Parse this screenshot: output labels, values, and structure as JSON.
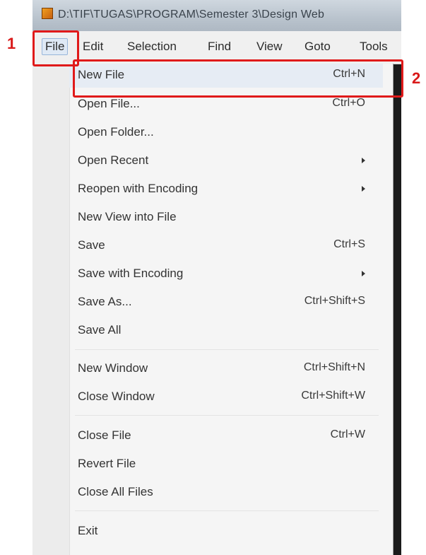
{
  "annotations": {
    "step1": "1",
    "step2": "2"
  },
  "window": {
    "title": "D:\\TIF\\TUGAS\\PROGRAM\\Semester 3\\Design Web"
  },
  "menubar": {
    "file": "File",
    "edit": "Edit",
    "selection": "Selection",
    "find": "Find",
    "view": "View",
    "goto": "Goto",
    "tools": "Tools"
  },
  "file_menu": {
    "new_file": {
      "label": "New File",
      "shortcut": "Ctrl+N"
    },
    "open_file": {
      "label": "Open File...",
      "shortcut": "Ctrl+O"
    },
    "open_folder": {
      "label": "Open Folder..."
    },
    "open_recent": {
      "label": "Open Recent"
    },
    "reopen_with_encoding": {
      "label": "Reopen with Encoding"
    },
    "new_view_into_file": {
      "label": "New View into File"
    },
    "save": {
      "label": "Save",
      "shortcut": "Ctrl+S"
    },
    "save_with_encoding": {
      "label": "Save with Encoding"
    },
    "save_as": {
      "label": "Save As...",
      "shortcut": "Ctrl+Shift+S"
    },
    "save_all": {
      "label": "Save All"
    },
    "new_window": {
      "label": "New Window",
      "shortcut": "Ctrl+Shift+N"
    },
    "close_window": {
      "label": "Close Window",
      "shortcut": "Ctrl+Shift+W"
    },
    "close_file": {
      "label": "Close File",
      "shortcut": "Ctrl+W"
    },
    "revert_file": {
      "label": "Revert File"
    },
    "close_all_files": {
      "label": "Close All Files"
    },
    "exit": {
      "label": "Exit"
    }
  },
  "colors": {
    "annotation": "#e01a1a",
    "highlight": "#e6ecf4"
  }
}
